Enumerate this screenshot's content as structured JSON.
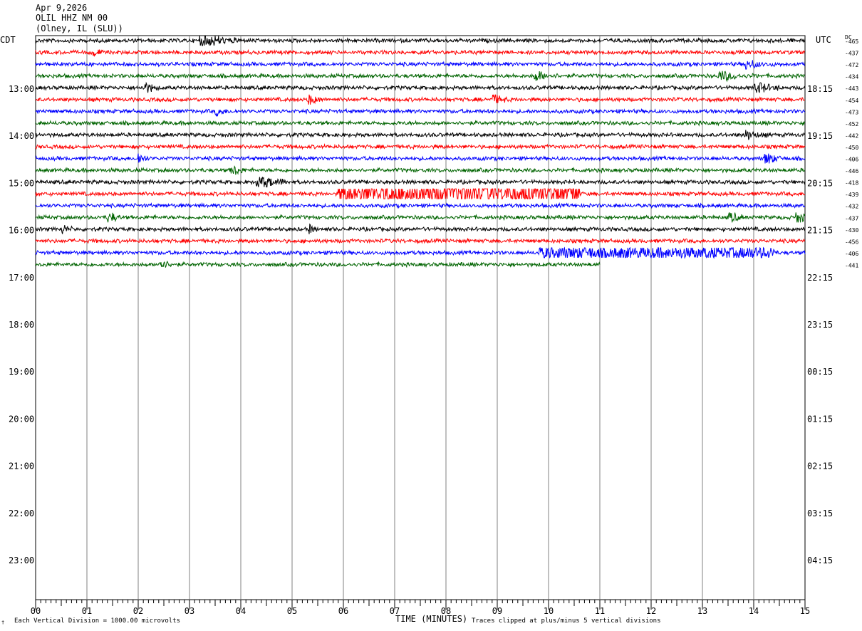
{
  "header": {
    "date": "Apr 9,2026",
    "station": "OLIL HHZ NM 00",
    "location": "(Olney, IL (SLU))"
  },
  "left_axis_title": "CDT",
  "right_axis_title": "UTC",
  "dc_title": "DC",
  "footer": {
    "scale_note": "Each Vertical Division = 1000.00 microvolts",
    "clip_note": "Traces clipped at plus/minus 5 vertical divisions",
    "corner_mark": "†"
  },
  "colors": {
    "trace_cycle": [
      "#000000",
      "#ff0000",
      "#0000ff",
      "#006400"
    ],
    "grid": "#808080"
  },
  "chart_data": {
    "type": "line",
    "xlabel": "TIME (MINUTES)",
    "x_ticks": [
      "00",
      "01",
      "02",
      "03",
      "04",
      "05",
      "06",
      "07",
      "08",
      "09",
      "10",
      "11",
      "12",
      "13",
      "14",
      "15"
    ],
    "xlim": [
      0,
      15
    ],
    "left_hour_labels": [
      "13:00",
      "14:00",
      "15:00",
      "16:00",
      "17:00",
      "18:00",
      "19:00",
      "20:00",
      "21:00",
      "22:00",
      "23:00"
    ],
    "right_hour_labels": [
      "18:15",
      "19:15",
      "20:15",
      "21:15",
      "22:15",
      "23:15",
      "00:15",
      "01:15",
      "02:15",
      "03:15",
      "04:15"
    ],
    "traces": [
      {
        "dc": "-465",
        "end_minute": 15,
        "events": [
          [
            3.2,
            0.8,
            2.0
          ]
        ]
      },
      {
        "dc": "-437",
        "end_minute": 15,
        "events": [
          [
            1.1,
            0.3,
            1.6
          ]
        ]
      },
      {
        "dc": "-472",
        "end_minute": 15,
        "events": [
          [
            13.8,
            0.6,
            1.6
          ]
        ]
      },
      {
        "dc": "-434",
        "end_minute": 15,
        "events": [
          [
            9.7,
            0.5,
            1.8
          ],
          [
            13.3,
            0.8,
            1.6
          ]
        ]
      },
      {
        "dc": "-443",
        "end_minute": 15,
        "events": [
          [
            2.1,
            0.3,
            2.0
          ],
          [
            14.0,
            0.5,
            2.0
          ]
        ]
      },
      {
        "dc": "-454",
        "end_minute": 15,
        "events": [
          [
            5.3,
            0.3,
            2.0
          ],
          [
            8.9,
            0.3,
            2.0
          ]
        ]
      },
      {
        "dc": "-473",
        "end_minute": 15,
        "events": [
          [
            3.5,
            0.3,
            1.6
          ]
        ]
      },
      {
        "dc": "-452",
        "end_minute": 15,
        "events": []
      },
      {
        "dc": "-442",
        "end_minute": 15,
        "events": [
          [
            13.8,
            0.5,
            1.7
          ]
        ]
      },
      {
        "dc": "-450",
        "end_minute": 15,
        "events": []
      },
      {
        "dc": "-406",
        "end_minute": 15,
        "events": [
          [
            2.0,
            0.2,
            2.0
          ],
          [
            14.2,
            0.4,
            2.0
          ]
        ]
      },
      {
        "dc": "-446",
        "end_minute": 15,
        "events": [
          [
            3.8,
            0.3,
            2.0
          ]
        ]
      },
      {
        "dc": "-418",
        "end_minute": 15,
        "events": [
          [
            4.3,
            0.6,
            2.6
          ]
        ]
      },
      {
        "dc": "-439",
        "end_minute": 15,
        "events": [
          [
            5.9,
            4.7,
            3.0
          ]
        ]
      },
      {
        "dc": "-432",
        "end_minute": 15,
        "events": []
      },
      {
        "dc": "-437",
        "end_minute": 15,
        "events": [
          [
            1.4,
            0.3,
            1.8
          ],
          [
            13.5,
            0.3,
            2.0
          ],
          [
            14.8,
            0.4,
            2.0
          ]
        ]
      },
      {
        "dc": "-430",
        "end_minute": 15,
        "events": [
          [
            0.5,
            0.2,
            1.8
          ],
          [
            5.3,
            0.2,
            1.8
          ]
        ]
      },
      {
        "dc": "-456",
        "end_minute": 15,
        "events": []
      },
      {
        "dc": "-406",
        "end_minute": 15,
        "events": [
          [
            9.8,
            4.6,
            1.6
          ]
        ]
      },
      {
        "dc": "-441",
        "end_minute": 11,
        "events": [
          [
            2.4,
            0.3,
            2.0
          ]
        ]
      }
    ]
  }
}
